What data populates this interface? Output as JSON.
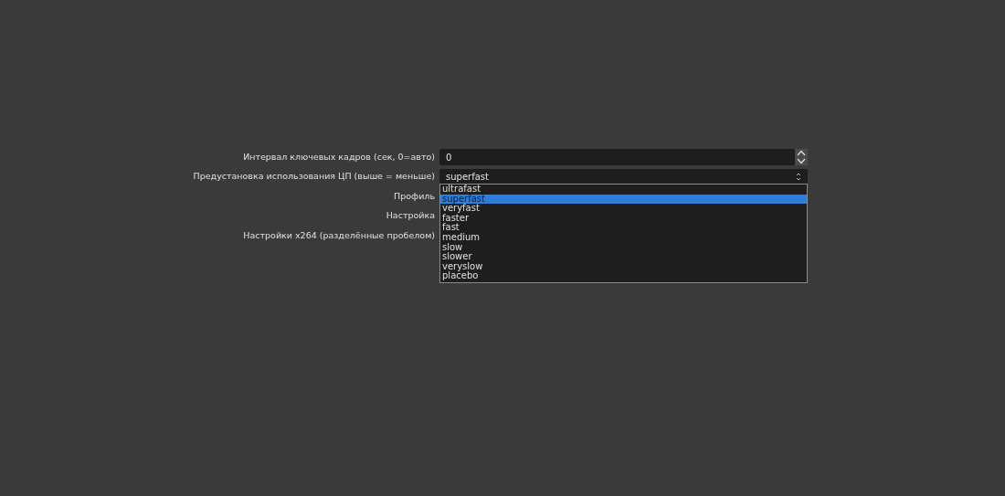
{
  "rows": [
    {
      "label": "Интервал ключевых кадров (сек, 0=авто)",
      "kind": "spinbox",
      "value": "0"
    },
    {
      "label": "Предустановка использования ЦП (выше = меньше)",
      "kind": "combobox",
      "value": "superfast",
      "expanded": true,
      "options": [
        {
          "text": "ultrafast",
          "selected": false
        },
        {
          "text": "superfast",
          "selected": true
        },
        {
          "text": "veryfast",
          "selected": false
        },
        {
          "text": "faster",
          "selected": false
        },
        {
          "text": "fast",
          "selected": false
        },
        {
          "text": "medium",
          "selected": false
        },
        {
          "text": "slow",
          "selected": false
        },
        {
          "text": "slower",
          "selected": false
        },
        {
          "text": "veryslow",
          "selected": false
        },
        {
          "text": "placebo",
          "selected": false
        }
      ]
    },
    {
      "label": "Профиль",
      "kind": "hidden"
    },
    {
      "label": "Настройка",
      "kind": "hidden"
    },
    {
      "label": "Настройки x264 (разделённые пробелом)",
      "kind": "hidden"
    }
  ]
}
